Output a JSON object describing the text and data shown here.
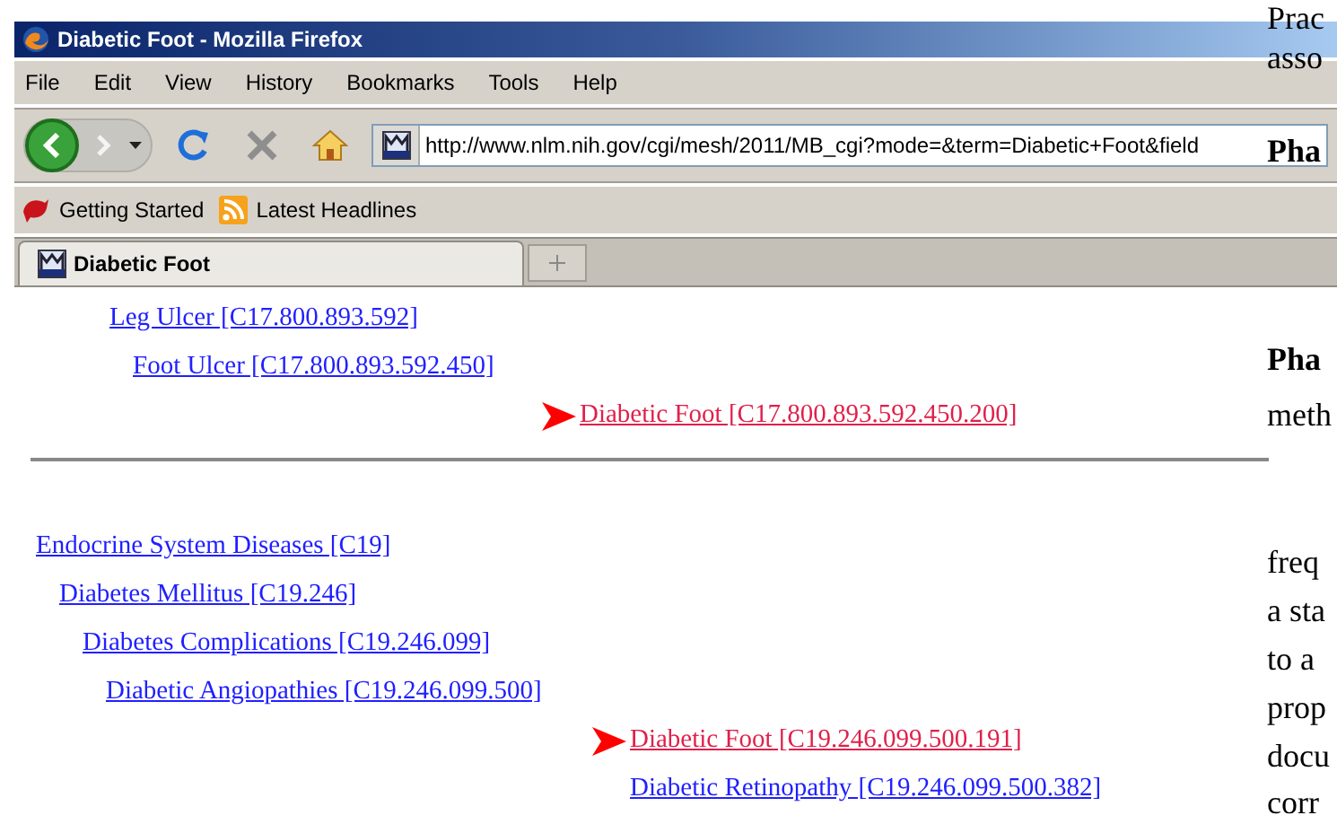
{
  "window": {
    "title": "Diabetic Foot - Mozilla Firefox"
  },
  "menu": [
    "File",
    "Edit",
    "View",
    "History",
    "Bookmarks",
    "Tools",
    "Help"
  ],
  "address_bar": {
    "value": "http://www.nlm.nih.gov/cgi/mesh/2011/MB_cgi?mode=&term=Diabetic+Foot&field"
  },
  "bookmarks": [
    {
      "label": "Getting Started",
      "kind": "page"
    },
    {
      "label": "Latest Headlines",
      "kind": "feed"
    }
  ],
  "tabs": [
    {
      "label": "Diabetic Foot",
      "selected": true
    }
  ],
  "trees": [
    {
      "items": [
        {
          "label": "Leg Ulcer [C17.800.893.592]",
          "current": false,
          "children": [
            {
              "label": "Foot Ulcer [C17.800.893.592.450]",
              "current": false,
              "children": [
                {
                  "label": "Diabetic Foot [C17.800.893.592.450.200]",
                  "current": true
                }
              ]
            }
          ]
        }
      ]
    },
    {
      "items": [
        {
          "label": "Endocrine System Diseases [C19]",
          "current": false,
          "children": [
            {
              "label": "Diabetes Mellitus [C19.246]",
              "current": false,
              "children": [
                {
                  "label": "Diabetes Complications [C19.246.099]",
                  "current": false,
                  "children": [
                    {
                      "label": "Diabetic Angiopathies [C19.246.099.500]",
                      "current": false,
                      "children": [
                        {
                          "label": "Diabetic Foot [C19.246.099.500.191]",
                          "current": true
                        },
                        {
                          "label": "Diabetic Retinopathy [C19.246.099.500.382]",
                          "current": false
                        }
                      ]
                    }
                  ]
                }
              ]
            }
          ]
        }
      ]
    }
  ],
  "background_document": [
    {
      "text": "Prac",
      "bold": false
    },
    {
      "text": "asso",
      "bold": false
    },
    {
      "text": "Pha",
      "bold": true
    },
    {
      "text": "Pha",
      "bold": true
    },
    {
      "text": "meth",
      "bold": false
    },
    {
      "text": "freq",
      "bold": false
    },
    {
      "text": "a sta",
      "bold": false
    },
    {
      "text": "to a",
      "bold": false
    },
    {
      "text": "prop",
      "bold": false
    },
    {
      "text": "docu",
      "bold": false
    },
    {
      "text": "corr",
      "bold": false
    }
  ]
}
